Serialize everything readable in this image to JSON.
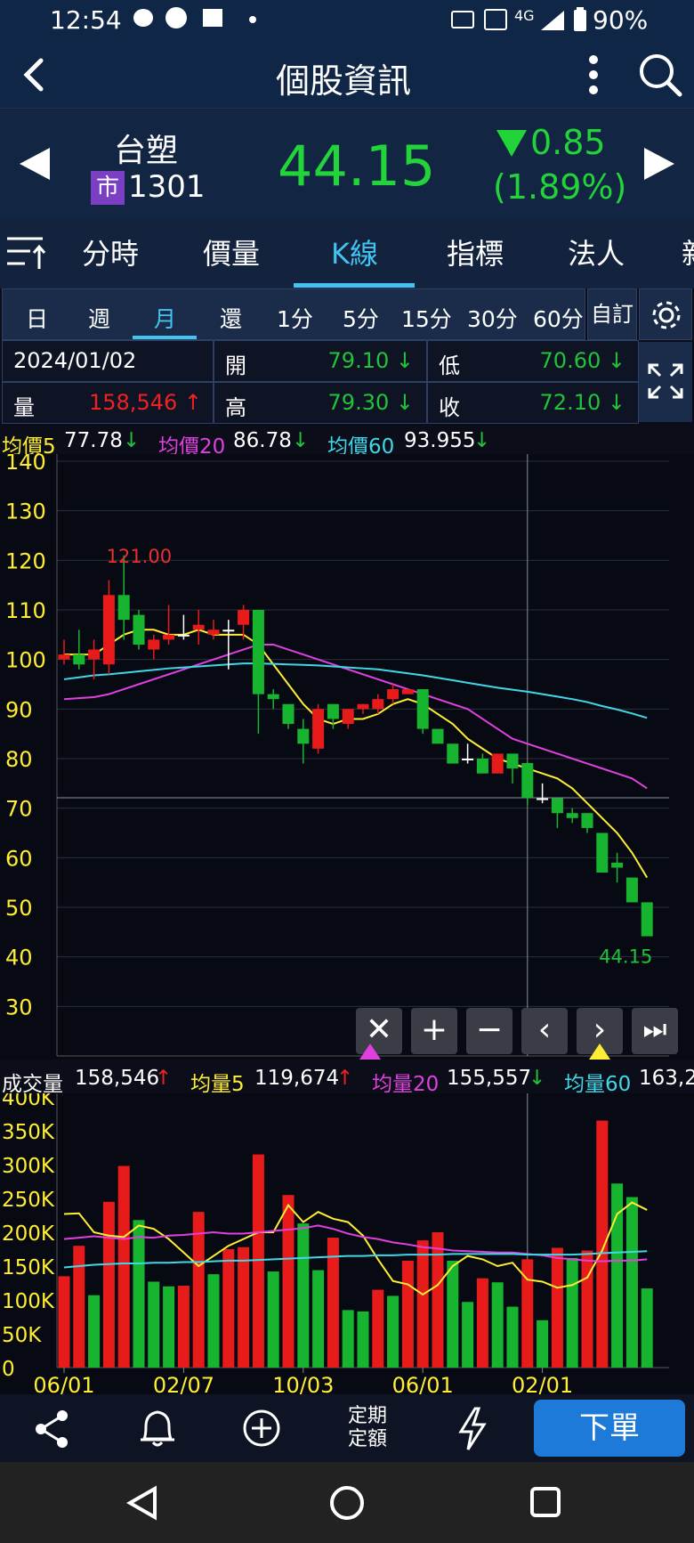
{
  "status_bar": {
    "time": "12:54",
    "network": "4G",
    "battery": "90%"
  },
  "header": {
    "title": "個股資訊"
  },
  "quote": {
    "name": "台塑",
    "market_badge": "市",
    "code": "1301",
    "price": "44.15",
    "change": "0.85",
    "change_pct": "(1.89%)",
    "price_color": "#22d33a"
  },
  "tabs": [
    "分時",
    "價量",
    "K線",
    "指標",
    "法人"
  ],
  "active_tab": "K線",
  "periods": [
    "日",
    "週",
    "月",
    "還",
    "1分",
    "5分",
    "15分",
    "30分",
    "60分"
  ],
  "active_period": "月",
  "custom_label": "自訂",
  "ohlc": {
    "date": "2024/01/02",
    "open_label": "開",
    "open": "79.10",
    "low_label": "低",
    "low": "70.60",
    "volume_label": "量",
    "volume": "158,546",
    "high_label": "高",
    "high": "79.30",
    "close_label": "收",
    "close": "72.10"
  },
  "ma_legend": [
    {
      "label": "均價5",
      "value": "77.78",
      "arrow": "↓",
      "color": "#ffee33"
    },
    {
      "label": "均價20",
      "value": "86.78",
      "arrow": "↓",
      "color": "#e040e0"
    },
    {
      "label": "均價60",
      "value": "93.955",
      "arrow": "↓",
      "color": "#40d8e8"
    }
  ],
  "vol_legend": {
    "label": "成交量",
    "value": "158,546",
    "arrow": "↑",
    "ma": [
      {
        "label": "均量5",
        "value": "119,674",
        "arrow": "↑",
        "color": "#ffee33"
      },
      {
        "label": "均量20",
        "value": "155,557",
        "arrow": "↓",
        "color": "#e040e0"
      },
      {
        "label": "均量60",
        "value": "163,2",
        "arrow": "",
        "color": "#40d8e8"
      }
    ]
  },
  "bottom_bar": {
    "plan_label_1": "定期",
    "plan_label_2": "定額",
    "order_button": "下單"
  },
  "chart_data": [
    {
      "type": "candlestick",
      "title": "",
      "ylim": [
        20,
        140
      ],
      "y_ticks": [
        "30",
        "40",
        "50",
        "60",
        "70",
        "80",
        "90",
        "100",
        "110",
        "120",
        "130",
        "140"
      ],
      "annotations": [
        "121.00",
        "44.15"
      ],
      "candles": [
        {
          "o": 100,
          "h": 104,
          "l": 99,
          "c": 101
        },
        {
          "o": 101,
          "h": 106,
          "l": 98,
          "c": 99
        },
        {
          "o": 100,
          "h": 104,
          "l": 96,
          "c": 102
        },
        {
          "o": 99,
          "h": 116,
          "l": 97,
          "c": 113
        },
        {
          "o": 113,
          "h": 121,
          "l": 104,
          "c": 108
        },
        {
          "o": 109,
          "h": 110,
          "l": 102,
          "c": 103
        },
        {
          "o": 102,
          "h": 105,
          "l": 100,
          "c": 104
        },
        {
          "o": 104,
          "h": 111,
          "l": 103,
          "c": 105
        },
        {
          "o": 105,
          "h": 109,
          "l": 104,
          "c": 105
        },
        {
          "o": 106,
          "h": 110,
          "l": 103,
          "c": 107
        },
        {
          "o": 105,
          "h": 108,
          "l": 104,
          "c": 106
        },
        {
          "o": 106,
          "h": 108,
          "l": 98,
          "c": 106
        },
        {
          "o": 107,
          "h": 111,
          "l": 104,
          "c": 110
        },
        {
          "o": 110,
          "h": 110,
          "l": 85,
          "c": 93
        },
        {
          "o": 93,
          "h": 94,
          "l": 90,
          "c": 92
        },
        {
          "o": 91,
          "h": 91,
          "l": 86,
          "c": 87
        },
        {
          "o": 86,
          "h": 88,
          "l": 79,
          "c": 83
        },
        {
          "o": 82,
          "h": 91,
          "l": 81,
          "c": 90
        },
        {
          "o": 91,
          "h": 91,
          "l": 86,
          "c": 88
        },
        {
          "o": 87,
          "h": 90,
          "l": 86,
          "c": 90
        },
        {
          "o": 90,
          "h": 91,
          "l": 89,
          "c": 91
        },
        {
          "o": 90,
          "h": 93,
          "l": 89,
          "c": 92
        },
        {
          "o": 92,
          "h": 95,
          "l": 91,
          "c": 94
        },
        {
          "o": 93,
          "h": 94,
          "l": 93,
          "c": 94
        },
        {
          "o": 94,
          "h": 94,
          "l": 85,
          "c": 86
        },
        {
          "o": 86,
          "h": 86,
          "l": 83,
          "c": 83
        },
        {
          "o": 83,
          "h": 83,
          "l": 79,
          "c": 79
        },
        {
          "o": 80,
          "h": 83,
          "l": 79,
          "c": 80
        },
        {
          "o": 80,
          "h": 81,
          "l": 77,
          "c": 77
        },
        {
          "o": 77,
          "h": 81,
          "l": 77,
          "c": 81
        },
        {
          "o": 81,
          "h": 81,
          "l": 75,
          "c": 78
        },
        {
          "o": 79.1,
          "h": 79.3,
          "l": 70.6,
          "c": 72.1
        },
        {
          "o": 72,
          "h": 75,
          "l": 71,
          "c": 72
        },
        {
          "o": 72,
          "h": 72,
          "l": 66,
          "c": 69
        },
        {
          "o": 69,
          "h": 70,
          "l": 67,
          "c": 68
        },
        {
          "o": 69,
          "h": 69,
          "l": 65,
          "c": 66
        },
        {
          "o": 65,
          "h": 65,
          "l": 57,
          "c": 57
        },
        {
          "o": 59,
          "h": 61,
          "l": 55,
          "c": 58
        },
        {
          "o": 56,
          "h": 56,
          "l": 51,
          "c": 51
        },
        {
          "o": 51,
          "h": 51,
          "l": 44.15,
          "c": 44.15
        }
      ],
      "series": [
        {
          "name": "均價5",
          "values": [
            101,
            101,
            101,
            103,
            105,
            106,
            106,
            105,
            105,
            106,
            105,
            105,
            105,
            103,
            99,
            95,
            91,
            88,
            87,
            88,
            88,
            89,
            91,
            92,
            91,
            89,
            87,
            84,
            82,
            80,
            79,
            78,
            77,
            76,
            74,
            71,
            68,
            65,
            61,
            56
          ]
        },
        {
          "name": "均價20",
          "values": [
            92,
            92.2,
            92.4,
            93,
            94,
            95,
            96,
            97,
            98,
            99,
            100,
            101,
            102,
            103,
            103,
            102,
            101,
            100,
            99,
            98,
            97,
            96,
            95,
            94,
            93,
            92,
            91,
            90,
            88,
            86,
            84,
            83,
            82,
            81,
            80,
            79,
            78,
            77,
            76,
            74
          ]
        },
        {
          "name": "均價60",
          "values": [
            96,
            96.4,
            96.8,
            97,
            97.3,
            97.6,
            97.9,
            98.2,
            98.4,
            98.6,
            98.8,
            99,
            99.2,
            99.2,
            99.1,
            99,
            98.9,
            98.8,
            98.6,
            98.4,
            98.2,
            98,
            97.6,
            97.2,
            96.8,
            96.3,
            95.8,
            95.3,
            94.8,
            94.3,
            93.9,
            93.5,
            93,
            92.5,
            92,
            91.4,
            90.6,
            89.9,
            89.1,
            88.2
          ]
        }
      ]
    },
    {
      "type": "bar",
      "title": "",
      "ylim": [
        0,
        400
      ],
      "y_ticks": [
        "0",
        "50K",
        "100K",
        "150K",
        "200K",
        "250K",
        "300K",
        "350K",
        "400K"
      ],
      "x_ticks": [
        {
          "label": "06/01",
          "index": 0
        },
        {
          "label": "02/07",
          "index": 8
        },
        {
          "label": "10/03",
          "index": 16
        },
        {
          "label": "06/01",
          "index": 24
        },
        {
          "label": "02/01",
          "index": 32
        }
      ],
      "values": [
        135,
        180,
        107,
        245,
        298,
        218,
        127,
        120,
        121,
        230,
        138,
        175,
        178,
        315,
        142,
        255,
        213,
        144,
        192,
        85,
        83,
        115,
        106,
        158,
        188,
        200,
        158,
        97,
        132,
        126,
        90,
        160,
        70,
        177,
        162,
        173,
        365,
        272,
        252,
        117
      ],
      "up": [
        1,
        1,
        0,
        1,
        1,
        0,
        0,
        0,
        1,
        1,
        0,
        1,
        1,
        1,
        0,
        1,
        0,
        0,
        1,
        0,
        0,
        1,
        0,
        1,
        1,
        1,
        0,
        0,
        1,
        0,
        0,
        1,
        0,
        1,
        0,
        1,
        1,
        0,
        0,
        0
      ],
      "series": [
        {
          "name": "均量5",
          "values": [
            227,
            228,
            200,
            195,
            193,
            210,
            205,
            190,
            170,
            150,
            165,
            180,
            190,
            200,
            200,
            240,
            215,
            230,
            220,
            215,
            195,
            160,
            128,
            123,
            108,
            122,
            150,
            165,
            160,
            150,
            155,
            130,
            127,
            118,
            122,
            133,
            173,
            227,
            244,
            233
          ]
        },
        {
          "name": "均量20",
          "values": [
            190,
            192,
            194,
            192,
            190,
            193,
            192,
            195,
            196,
            198,
            200,
            198,
            198,
            200,
            202,
            204,
            206,
            210,
            205,
            198,
            193,
            190,
            185,
            182,
            178,
            176,
            173,
            172,
            171,
            170,
            170,
            168,
            166,
            162,
            160,
            158,
            157,
            158,
            158,
            160
          ]
        },
        {
          "name": "均量60",
          "values": [
            148,
            150,
            152,
            153,
            154,
            154,
            155,
            155,
            156,
            156,
            157,
            158,
            158,
            159,
            160,
            161,
            162,
            163,
            164,
            165,
            165,
            166,
            166,
            167,
            167,
            167,
            168,
            168,
            168,
            168,
            168,
            167,
            167,
            167,
            167,
            168,
            169,
            170,
            171,
            172
          ]
        }
      ]
    }
  ],
  "colors": {
    "up": "#e81b1b",
    "down": "#17b52f",
    "bg": "#0b0d18",
    "accent": "#41c4f0",
    "tick_label": "#ffee33"
  }
}
